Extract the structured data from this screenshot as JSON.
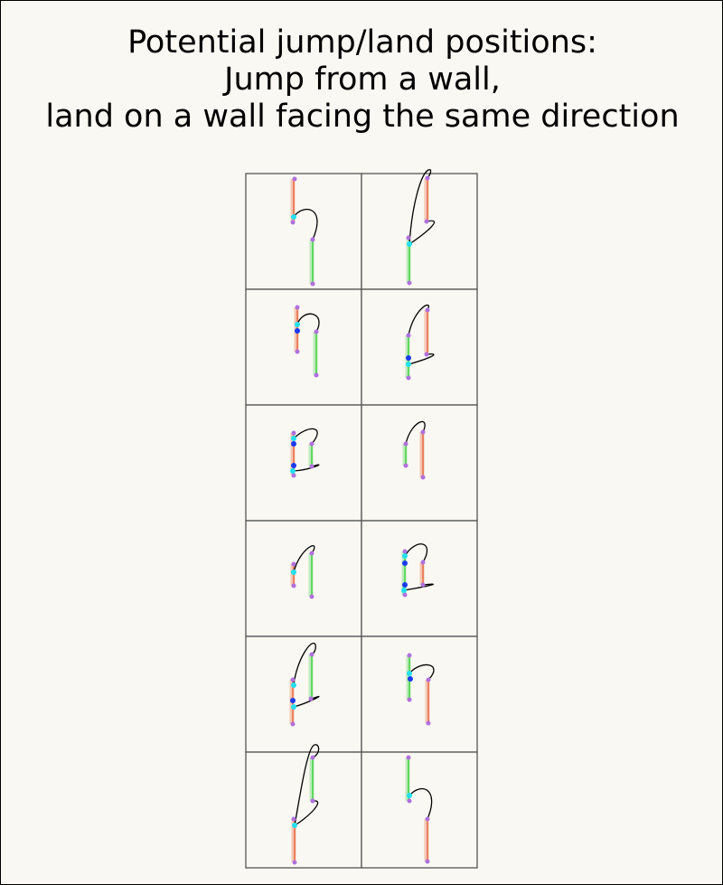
{
  "title": {
    "line1": "Potential jump/land positions:",
    "line2": "Jump from a wall,",
    "line3": "land on a wall facing the same direction"
  },
  "colors": {
    "background": "#f9f8f2",
    "grid_line": "#555555",
    "wall_red": "#e8502a",
    "wall_green": "#22cc22",
    "endpoint": "#b070e0",
    "jump_point": "#22e0f0",
    "land_point": "#1a3af0",
    "trajectory": "#000000"
  },
  "grid": {
    "rows": 6,
    "columns": 2
  }
}
